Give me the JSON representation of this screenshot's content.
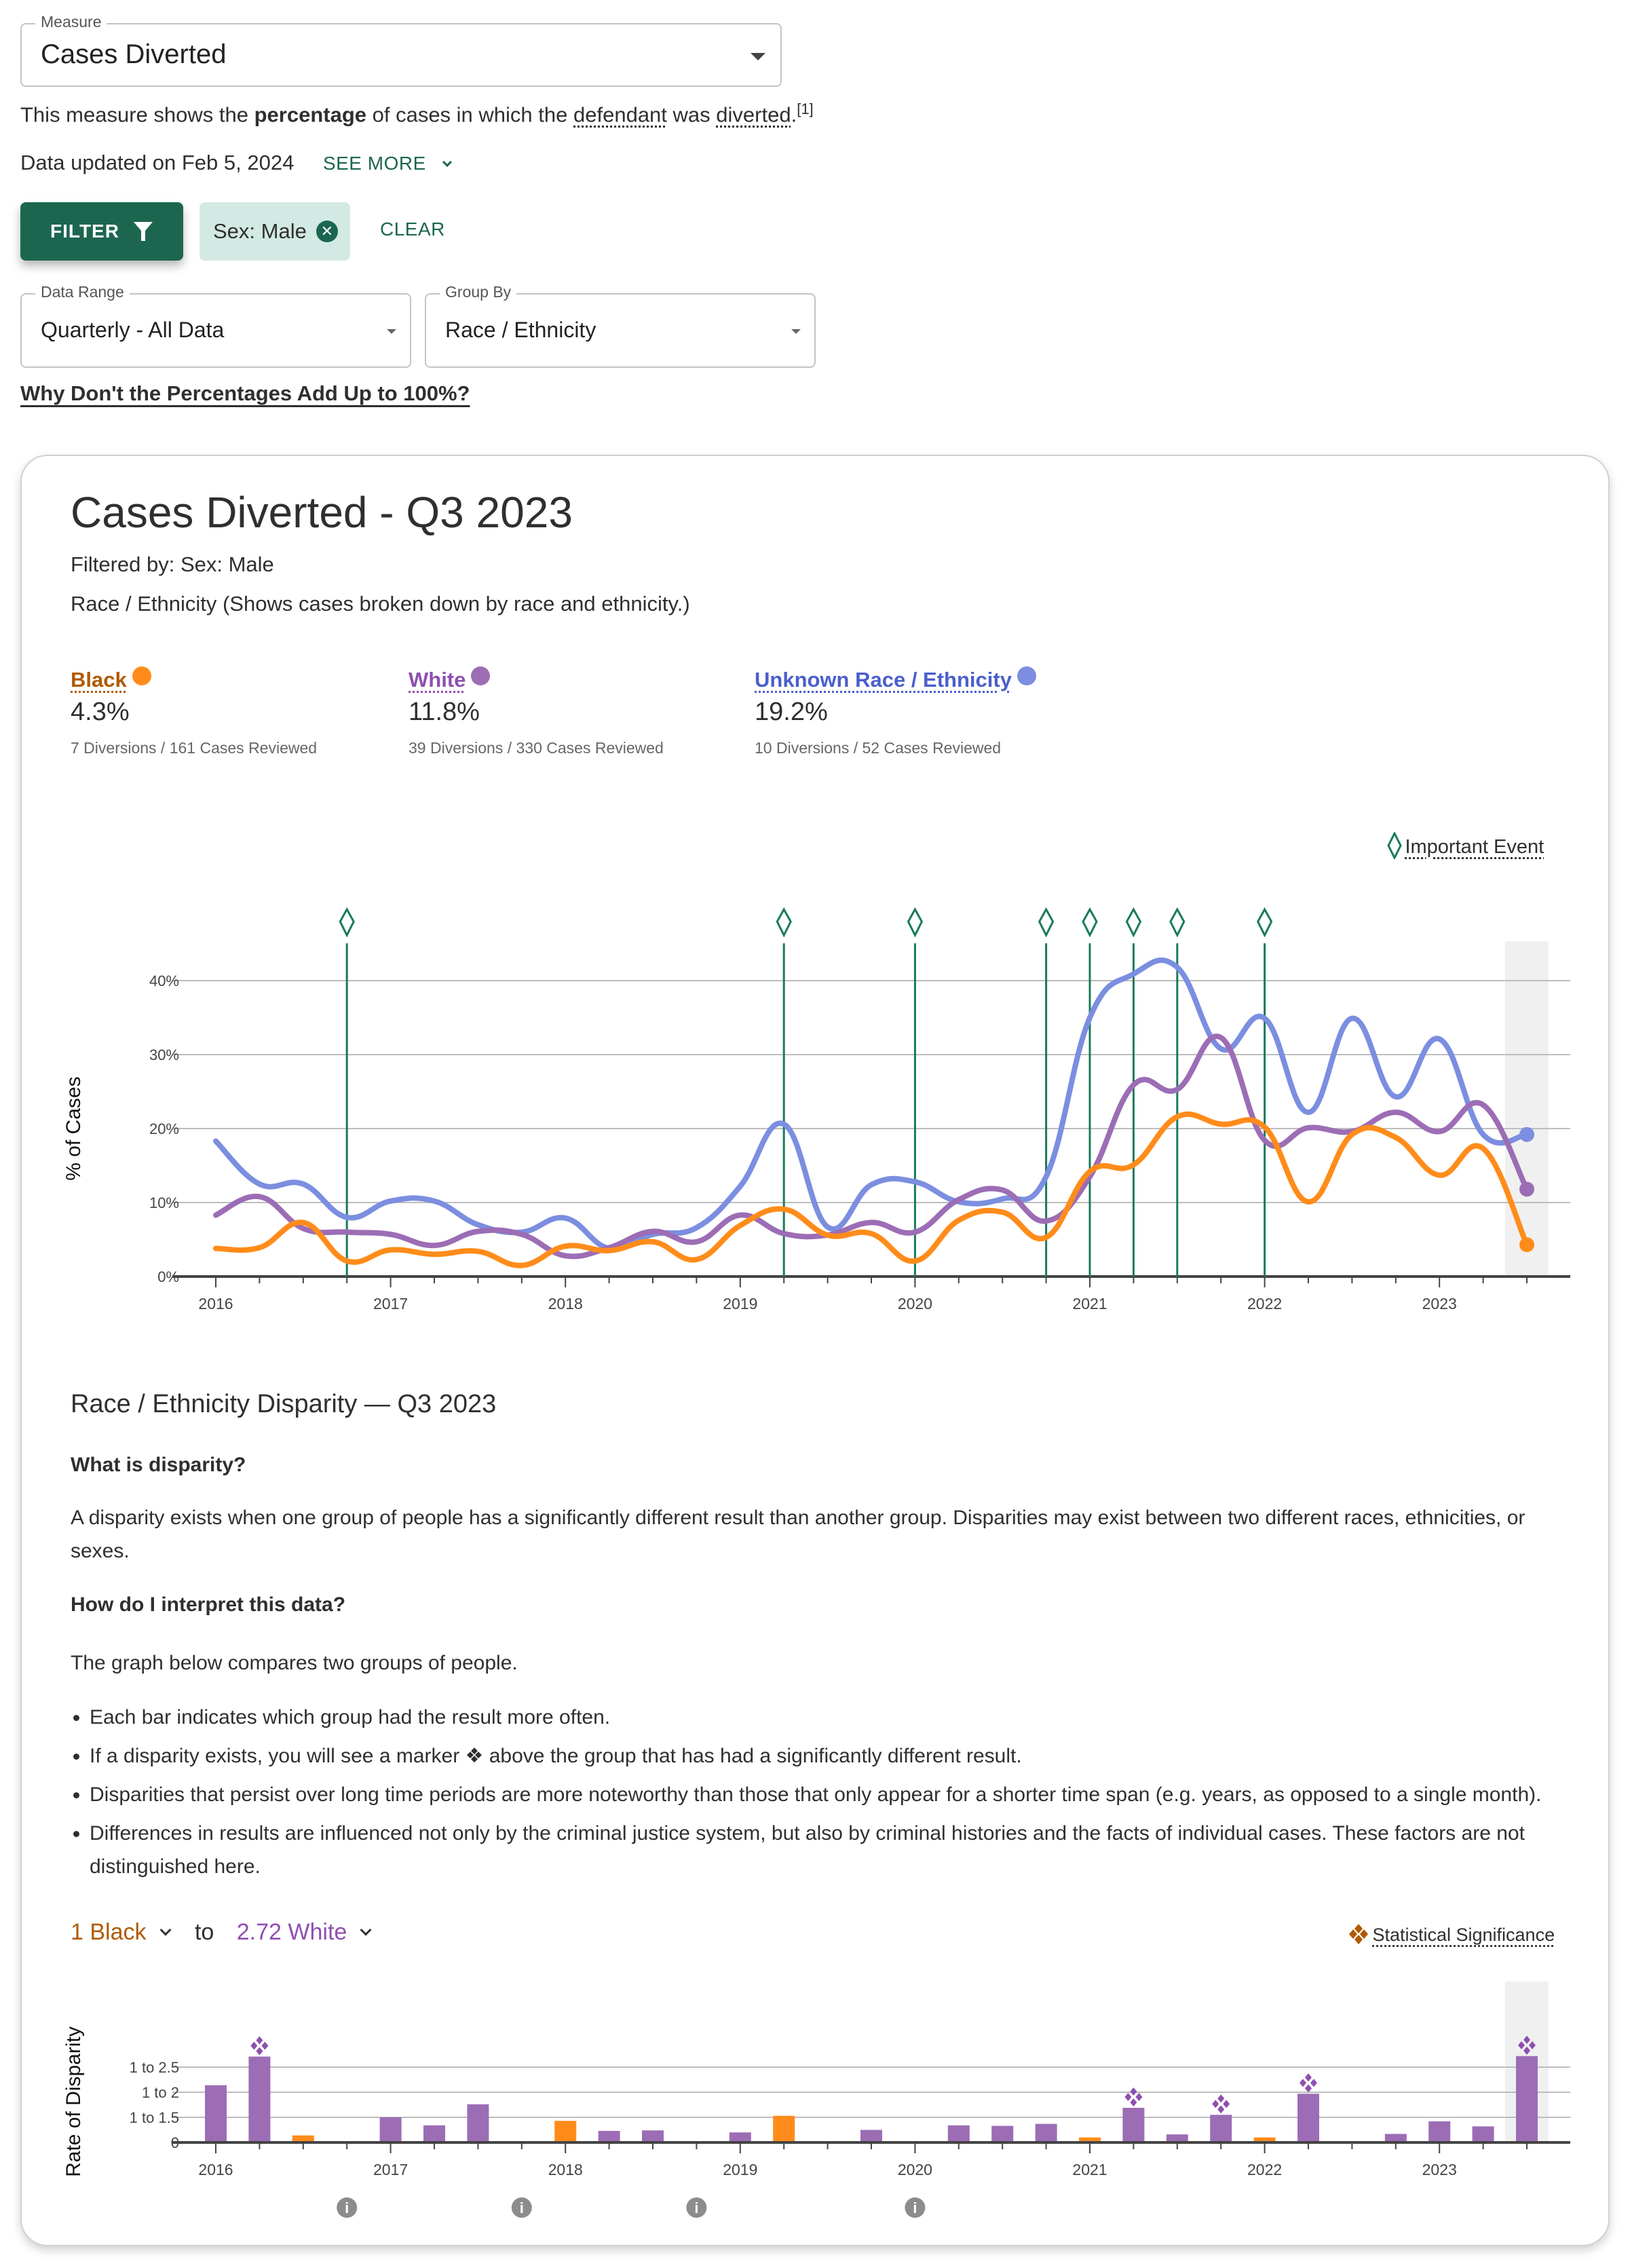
{
  "measure": {
    "legend": "Measure",
    "value": "Cases Diverted"
  },
  "description": {
    "prefix": "This measure shows the ",
    "bold": "percentage",
    "middle": " of cases in which the ",
    "term1": "defendant",
    "between": " was ",
    "term2": "diverted",
    "suffix": ".",
    "footnote": "[1]"
  },
  "updated": {
    "text": "Data updated on Feb 5, 2024",
    "see_more": "SEE MORE"
  },
  "filters": {
    "filter_button": "FILTER",
    "chips": [
      {
        "label": "Sex: Male"
      }
    ],
    "clear": "CLEAR"
  },
  "selects": {
    "data_range": {
      "legend": "Data Range",
      "value": "Quarterly - All Data"
    },
    "group_by": {
      "legend": "Group By",
      "value": "Race / Ethnicity"
    }
  },
  "why_link": "Why Don't the Percentages Add Up to 100%?",
  "card": {
    "title": "Cases Diverted - Q3 2023",
    "filtered_by": "Filtered by: Sex: Male",
    "group_desc": "Race / Ethnicity (Shows cases broken down by race and ethnicity.)",
    "groups": [
      {
        "label": "Black",
        "value": "4.3%",
        "count": "7 Diversions / 161 Cases Reviewed",
        "color": "#ff8c1a",
        "text_color": "#b05a00"
      },
      {
        "label": "White",
        "value": "11.8%",
        "count": "39 Diversions / 330 Cases Reviewed",
        "color": "#9c6db5",
        "text_color": "#8e4fb0"
      },
      {
        "label": "Unknown Race / Ethnicity",
        "value": "19.2%",
        "count": "10 Diversions / 52 Cases Reviewed",
        "color": "#7b8ee0",
        "text_color": "#4a5fcc"
      }
    ],
    "event_legend": "Important Event",
    "disparity": {
      "title": "Race / Ethnicity Disparity — Q3 2023",
      "q1": "What is disparity?",
      "p1": "A disparity exists when one group of people has a significantly different result than another group. Disparities may exist between two different races, ethnicities, or sexes.",
      "q2": "How do I interpret this data?",
      "p2": "The graph below compares two groups of people.",
      "bullets": [
        "Each bar indicates which group had the result more often.",
        "If a disparity exists, you will see a marker ❖ above the group that has had a significantly different result.",
        "Disparities that persist over long time periods are more noteworthy than those that only appear for a shorter time span (e.g. years, as opposed to a single month).",
        "Differences in results are influenced not only by the criminal justice system, but also by criminal histories and the facts of individual cases. These factors are not distinguished here."
      ],
      "compare": {
        "left": "1 Black",
        "to": "to",
        "right": "2.72 White",
        "left_color": "#b05a00",
        "right_color": "#8e4fb0"
      },
      "sig_legend": "Statistical Significance"
    }
  },
  "colors": {
    "brand": "#1c6650",
    "chip_bg": "#d3e9e3",
    "event": "#1a7a5c",
    "sig_marker": "#b05a00"
  },
  "chart_data": [
    {
      "type": "line",
      "title": "Cases Diverted - Q3 2023",
      "xlabel": "",
      "ylabel": "% of Cases",
      "ylim": [
        0,
        40
      ],
      "yticks": [
        "0%",
        "10%",
        "20%",
        "30%",
        "40%"
      ],
      "xticks": [
        "2016",
        "2017",
        "2018",
        "2019",
        "2020",
        "2021",
        "2022",
        "2023"
      ],
      "x": [
        "2016 Q1",
        "2016 Q2",
        "2016 Q3",
        "2016 Q4",
        "2017 Q1",
        "2017 Q2",
        "2017 Q3",
        "2017 Q4",
        "2018 Q1",
        "2018 Q2",
        "2018 Q3",
        "2018 Q4",
        "2019 Q1",
        "2019 Q2",
        "2019 Q3",
        "2019 Q4",
        "2020 Q1",
        "2020 Q2",
        "2020 Q3",
        "2020 Q4",
        "2021 Q1",
        "2021 Q2",
        "2021 Q3",
        "2021 Q4",
        "2022 Q1",
        "2022 Q2",
        "2022 Q3",
        "2022 Q4",
        "2023 Q1",
        "2023 Q2",
        "2023 Q3"
      ],
      "grid": true,
      "highlighted": "2023 Q3",
      "events": [
        "2016 Q4",
        "2019 Q2",
        "2020 Q1",
        "2020 Q4",
        "2021 Q1",
        "2021 Q2",
        "2021 Q3",
        "2022 Q1"
      ],
      "series": [
        {
          "name": "Black",
          "color": "#ff8c1a",
          "values": [
            3.8,
            3.9,
            7.3,
            2.1,
            3.6,
            3.0,
            3.4,
            1.5,
            4.1,
            3.5,
            4.7,
            2.3,
            6.9,
            9.1,
            5.6,
            5.8,
            2.1,
            7.6,
            8.7,
            5.3,
            14.2,
            15.1,
            21.6,
            20.6,
            20.2,
            10.1,
            19.2,
            18.8,
            13.7,
            17.3,
            4.3
          ]
        },
        {
          "name": "White",
          "color": "#9c6db5",
          "values": [
            8.3,
            10.8,
            6.5,
            6.0,
            5.7,
            4.2,
            6.1,
            5.7,
            2.8,
            3.9,
            6.1,
            4.7,
            8.3,
            5.8,
            5.6,
            7.3,
            6.0,
            10.4,
            11.7,
            7.5,
            13.5,
            25.9,
            25.3,
            32.3,
            18.4,
            20.1,
            19.6,
            22.2,
            19.6,
            23.2,
            11.8
          ]
        },
        {
          "name": "Unknown Race / Ethnicity",
          "color": "#7b8ee0",
          "values": [
            18.3,
            12.5,
            12.5,
            8.0,
            10.2,
            10.2,
            7.0,
            6.0,
            7.9,
            3.8,
            5.7,
            6.6,
            12.2,
            20.6,
            6.7,
            12.4,
            12.8,
            10.1,
            10.5,
            13.5,
            35.0,
            40.9,
            41.8,
            30.8,
            34.9,
            22.2,
            34.9,
            24.3,
            32.1,
            19.2,
            19.2
          ]
        }
      ],
      "legend": "event legend top-right"
    },
    {
      "type": "bar",
      "title": "Race / Ethnicity Disparity — Q3 2023",
      "xlabel": "",
      "ylabel": "Rate of Disparity",
      "yticks": [
        "0",
        "1 to 1.5",
        "1 to 2",
        "1 to 2.5"
      ],
      "ylim": [
        1,
        2.9
      ],
      "xticks": [
        "2016",
        "2017",
        "2018",
        "2019",
        "2020",
        "2021",
        "2022",
        "2023"
      ],
      "categories": [
        "2016 Q1",
        "2016 Q2",
        "2016 Q3",
        "2016 Q4",
        "2017 Q1",
        "2017 Q2",
        "2017 Q3",
        "2017 Q4",
        "2018 Q1",
        "2018 Q2",
        "2018 Q3",
        "2018 Q4",
        "2019 Q1",
        "2019 Q2",
        "2019 Q3",
        "2019 Q4",
        "2020 Q1",
        "2020 Q2",
        "2020 Q3",
        "2020 Q4",
        "2021 Q1",
        "2021 Q2",
        "2021 Q3",
        "2021 Q4",
        "2022 Q1",
        "2022 Q2",
        "2022 Q3",
        "2022 Q4",
        "2023 Q1",
        "2023 Q2",
        "2023 Q3"
      ],
      "values": [
        2.14,
        2.71,
        1.14,
        null,
        1.5,
        1.34,
        1.76,
        null,
        1.43,
        1.23,
        1.24,
        null,
        1.2,
        1.53,
        null,
        1.25,
        null,
        1.34,
        1.33,
        1.37,
        1.1,
        1.69,
        1.16,
        1.55,
        1.1,
        1.97,
        1.01,
        1.17,
        1.42,
        1.32,
        2.72
      ],
      "higher_group": [
        "White",
        "White",
        "Black",
        null,
        "White",
        "White",
        "White",
        null,
        "Black",
        "White",
        "White",
        null,
        "White",
        "Black",
        null,
        "White",
        null,
        "White",
        "White",
        "White",
        "Black",
        "White",
        "White",
        "White",
        "Black",
        "White",
        "White",
        "White",
        "White",
        "White",
        "White"
      ],
      "significant": [
        false,
        true,
        false,
        false,
        false,
        false,
        false,
        false,
        false,
        false,
        false,
        false,
        false,
        false,
        false,
        false,
        false,
        false,
        false,
        false,
        false,
        true,
        false,
        true,
        false,
        true,
        false,
        false,
        false,
        false,
        true
      ],
      "info_markers": [
        "2016 Q4",
        "2017 Q4",
        "2018 Q4",
        "2020 Q1"
      ],
      "group_colors": {
        "Black": "#ff8c1a",
        "White": "#9c6db5"
      },
      "highlighted": "2023 Q3",
      "grid": true,
      "legend": "top-right"
    }
  ]
}
